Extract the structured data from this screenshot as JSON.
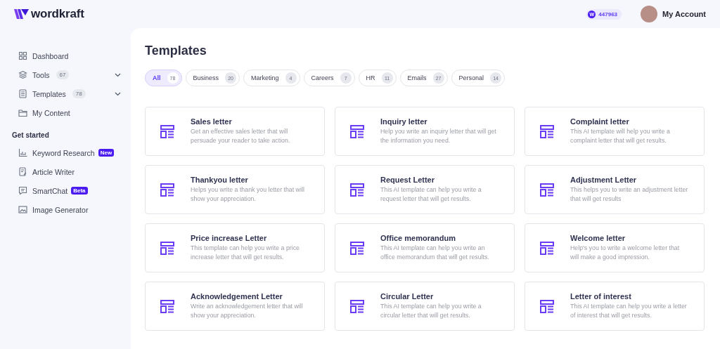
{
  "header": {
    "brand": "wordkraft",
    "credits": {
      "symbol": "W",
      "amount": "447963"
    },
    "account": "My Account"
  },
  "sidebar": {
    "items": [
      {
        "label": "Dashboard",
        "expandable": false
      },
      {
        "label": "Tools",
        "count": "67",
        "expandable": true,
        "expanded": false
      },
      {
        "label": "Templates",
        "count": "78",
        "expandable": true,
        "expanded": false
      },
      {
        "label": "My Content",
        "expandable": false
      }
    ],
    "section_title": "Get started",
    "tools": [
      {
        "label": "Keyword Research",
        "badge": "New"
      },
      {
        "label": "Article Writer"
      },
      {
        "label": "SmartChat",
        "badge": "Beta"
      },
      {
        "label": "Image Generator"
      }
    ]
  },
  "page": {
    "title": "Templates",
    "tabs": [
      {
        "label": "All",
        "count": "78",
        "selected": true
      },
      {
        "label": "Business",
        "count": "20",
        "selected": false
      },
      {
        "label": "Marketing",
        "count": "4",
        "selected": false
      },
      {
        "label": "Careers",
        "count": "7",
        "selected": false
      },
      {
        "label": "HR",
        "count": "11",
        "selected": false
      },
      {
        "label": "Emails",
        "count": "27",
        "selected": false
      },
      {
        "label": "Personal",
        "count": "14",
        "selected": false
      }
    ],
    "cards": [
      {
        "title": "Sales letter",
        "description": "Get an effective sales letter that will persuade your reader to take action."
      },
      {
        "title": "Inquiry letter",
        "description": "Help you write an inquiry letter that will get the information you need."
      },
      {
        "title": "Complaint letter",
        "description": "This AI template will help you write a complaint letter that will get results."
      },
      {
        "title": "Thankyou letter",
        "description": "Helps you write a thank you letter that will show your appreciation."
      },
      {
        "title": "Request Letter",
        "description": "This AI template can help you write a request letter that will get results."
      },
      {
        "title": "Adjustment Letter",
        "description": "This helps you to write an adjustment letter that will get results"
      },
      {
        "title": "Price increase Letter",
        "description": "This template can help you write a price increase letter that will get results."
      },
      {
        "title": "Office memorandum",
        "description": "This AI template can help you write an office memorandum that will get results."
      },
      {
        "title": "Welcome letter",
        "description": "Help's you to write a welcome letter that will make a good impression."
      },
      {
        "title": "Acknowledgement Letter",
        "description": "Write an acknowledgement letter that will show your appreciation."
      },
      {
        "title": "Circular Letter",
        "description": "This AI template can help you write a circular letter that will get results."
      },
      {
        "title": "Letter of interest",
        "description": "This AI template can help you write a letter of interest that will get results."
      }
    ]
  }
}
